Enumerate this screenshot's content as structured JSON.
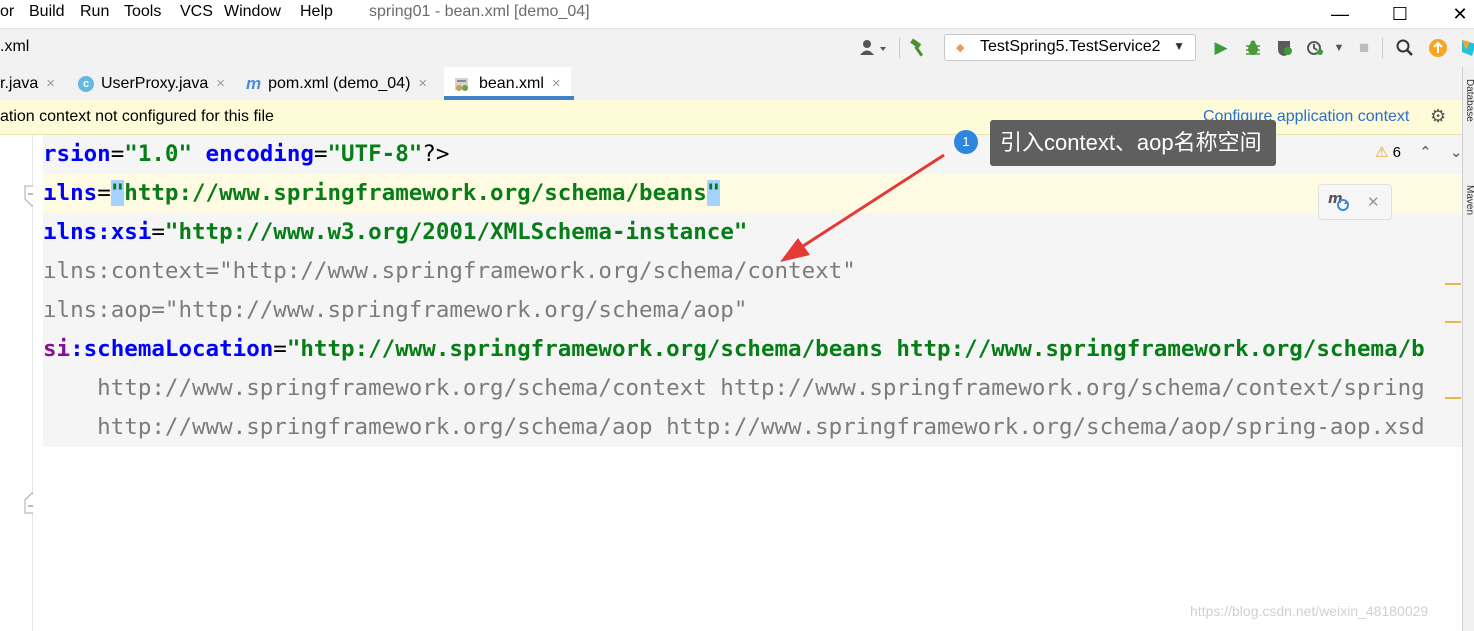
{
  "menu": {
    "items": [
      "or",
      "Build",
      "Run",
      "Tools",
      "VCS",
      "Window",
      "Help"
    ],
    "window_title": "spring01 - bean.xml [demo_04]",
    "minimize": "—",
    "maximize": "☐",
    "close": "✕"
  },
  "toolbar": {
    "breadcrumb": ".xml",
    "run_config": "TestSpring5.TestService2"
  },
  "tabs": [
    {
      "label": "r.java",
      "icon": "java-icon",
      "close": "×"
    },
    {
      "label": "UserProxy.java",
      "icon": "class-icon",
      "close": "×"
    },
    {
      "label": "pom.xml (demo_04)",
      "icon": "maven-icon",
      "close": "×"
    },
    {
      "label": "bean.xml",
      "icon": "xml-icon",
      "close": "×",
      "active": true
    }
  ],
  "banner": {
    "message": "ation context not configured for this file",
    "link": "Configure application context"
  },
  "editor": {
    "warning_count": "6",
    "lines": [
      {
        "p1": "rsion",
        "p2": "=",
        "p3": "\"1.0\"",
        "p4": " encoding",
        "p5": "=",
        "p6": "\"UTF-8\"",
        "p7": "?>"
      },
      {
        "p1": "ılns",
        "p2": "=",
        "p3": "\"",
        "p4": "http://www.springframework.org/schema/beans",
        "p5": "\""
      },
      {
        "p1": "ılns:xsi",
        "p2": "=",
        "p3": "\"http://www.w3.org/2001/XMLSchema-instance\""
      },
      {
        "text": "ılns:context=\"http://www.springframework.org/schema/context\""
      },
      {
        "text": "ılns:aop=\"http://www.springframework.org/schema/aop\""
      },
      {
        "p1": "si",
        "p2": ":schemaLocation",
        "p3": "=",
        "p4": "\"http://www.springframework.org/schema/beans http://www.springframework.org/schema/b"
      },
      {
        "text": "    http://www.springframework.org/schema/context http://www.springframework.org/schema/context/spring"
      },
      {
        "text": "    http://www.springframework.org/schema/aop http://www.springframework.org/schema/aop/spring-aop.xsd"
      }
    ]
  },
  "side_tools": [
    "Database",
    "Maven"
  ],
  "annotation": {
    "badge": "1",
    "text": "引入context、aop名称空间"
  },
  "watermark": "https://blog.csdn.net/weixin_48180029",
  "colors": {
    "banner_bg": "#fefbd8",
    "link": "#2a6fd0",
    "arrow": "#e53935",
    "callout_bg": "#5f5f5f",
    "badge": "#2f86dd"
  }
}
